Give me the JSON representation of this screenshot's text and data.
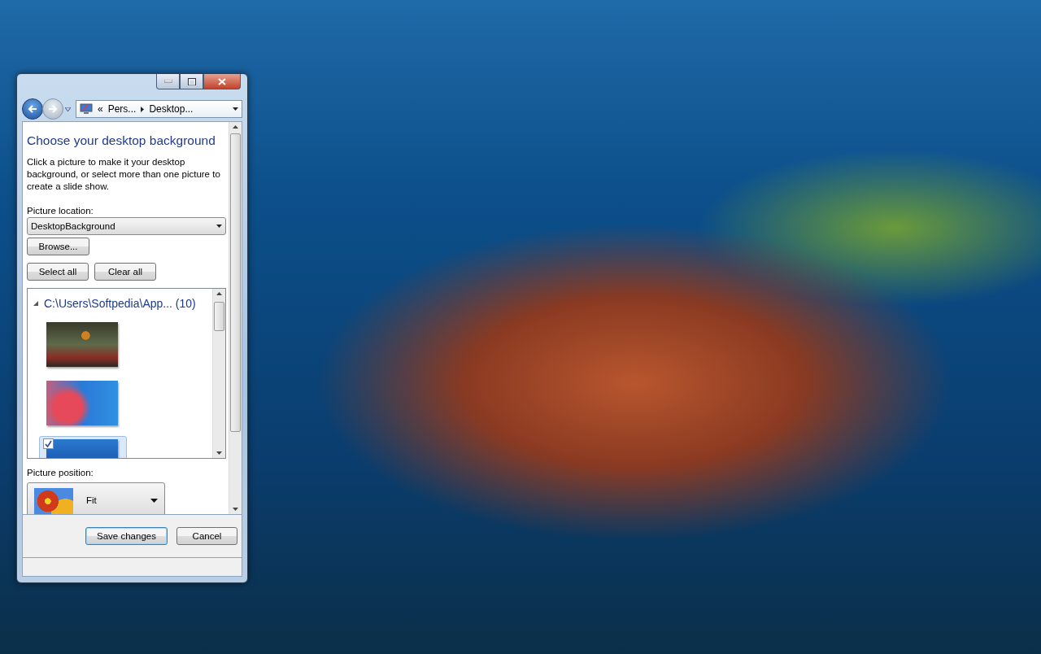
{
  "address_bar": {
    "overflow": "«",
    "crumbs": [
      "Pers...",
      "Desktop..."
    ]
  },
  "heading": "Choose your desktop background",
  "description": "Click a picture to make it your desktop background, or select more than one picture to create a slide show.",
  "picture_location": {
    "label": "Picture location:",
    "value": "DesktopBackground",
    "browse": "Browse..."
  },
  "selection_buttons": [
    "Select all",
    "Clear all"
  ],
  "picture_list": {
    "group": {
      "label": "C:\\Users\\Softpedia\\App... (10)",
      "expanded": true
    },
    "pictures": [
      {
        "checked": false,
        "selected": false
      },
      {
        "checked": false,
        "selected": false
      },
      {
        "checked": true,
        "selected": true
      }
    ]
  },
  "picture_position": {
    "label": "Picture position:",
    "value": "Fit"
  },
  "buttons": [
    {
      "label": "Save changes",
      "default": true
    },
    {
      "label": "Cancel",
      "default": false
    }
  ]
}
